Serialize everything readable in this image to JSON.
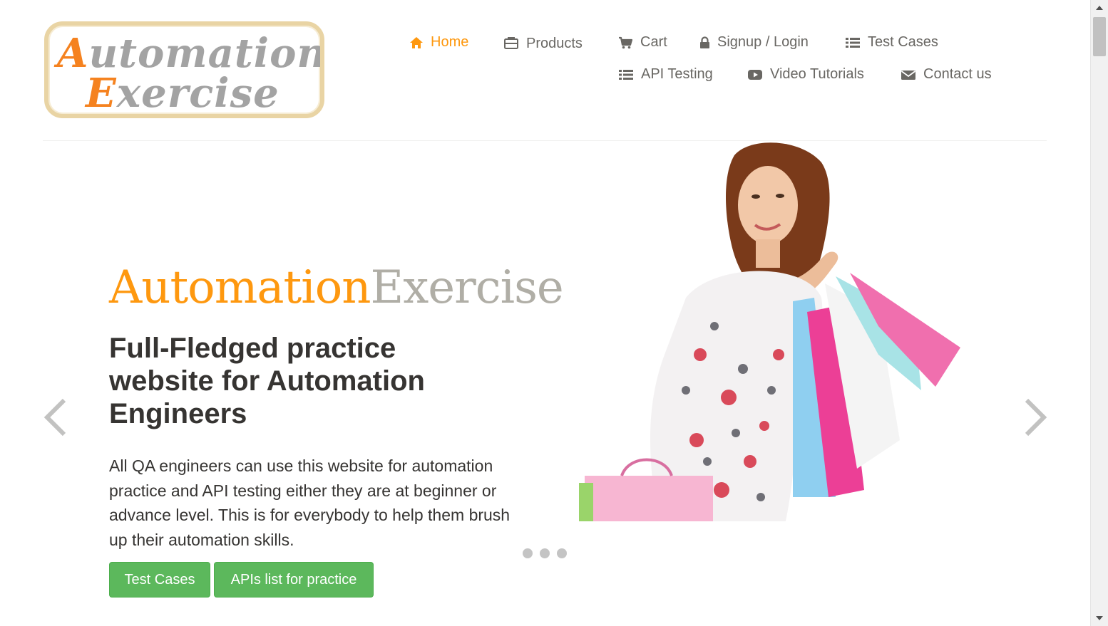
{
  "logo": {
    "line1_cap": "A",
    "line1_rest": "utomation",
    "line2_cap": "E",
    "line2_rest": "xercise"
  },
  "nav": {
    "home": {
      "label": "Home",
      "icon": "home-icon"
    },
    "products": {
      "label": "Products",
      "icon": "briefcase-icon"
    },
    "cart": {
      "label": "Cart",
      "icon": "cart-icon"
    },
    "login": {
      "label": "Signup / Login",
      "icon": "lock-icon"
    },
    "test_cases": {
      "label": "Test Cases",
      "icon": "list-icon"
    },
    "api_testing": {
      "label": "API Testing",
      "icon": "list-icon"
    },
    "video": {
      "label": "Video Tutorials",
      "icon": "youtube-play-icon"
    },
    "contact": {
      "label": "Contact us",
      "icon": "envelope-icon"
    }
  },
  "slider": {
    "brand_part1": "Automation",
    "brand_part2": "Exercise",
    "headline": "Full-Fledged practice website for Automation Engineers",
    "description": "All QA engineers can use this website for automation practice and API testing either they are at beginner or advance level. This is for everybody to help them brush up their automation skills.",
    "button_test_cases": "Test Cases",
    "button_apis": "APIs list for practice",
    "dots_count": 3
  },
  "colors": {
    "accent": "#fe980f",
    "button_green": "#5cb85c",
    "text_dark": "#363432",
    "text_nav": "#696763"
  }
}
